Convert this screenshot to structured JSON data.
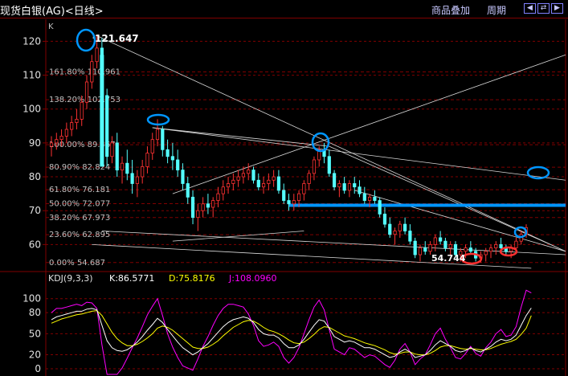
{
  "header": {
    "title": "现货白银(AG)<日线>",
    "menu_overlay": "商品叠加",
    "menu_period": "周期",
    "nav_icons": [
      "collapse-left-icon",
      "expand-icon",
      "collapse-right-icon"
    ]
  },
  "colors": {
    "bg": "#000000",
    "up": "#ff3232",
    "down": "#54ffff",
    "grid": "#800000",
    "k_line": "#ffffff",
    "d_line": "#ffff00",
    "j_line": "#ff00ff",
    "highlight": "#0096ff",
    "marker_red": "#ff3030"
  },
  "chart_data": [
    {
      "type": "candlestick",
      "panel_label": "K",
      "ylim": [
        52.5,
        126.5
      ],
      "y_ticks": [
        60,
        70,
        80,
        90,
        100,
        110,
        120
      ],
      "grid": true,
      "fib_levels": [
        {
          "label": "161.80% 110.961",
          "value": 110.961
        },
        {
          "label": "138.20% 102.753",
          "value": 102.753
        },
        {
          "label": "100.00% 89.467",
          "value": 89.467
        },
        {
          "label": "80.90% 82.824",
          "value": 82.824
        },
        {
          "label": "61.80% 76.181",
          "value": 76.181
        },
        {
          "label": "50.00% 72.077",
          "value": 72.077
        },
        {
          "label": "38.20% 67.973",
          "value": 67.973
        },
        {
          "label": "23.60% 62.895",
          "value": 62.895
        },
        {
          "label": "0.00% 54.687",
          "value": 54.687
        }
      ],
      "annotations": {
        "high_label": "121.647",
        "high_value": 121.647,
        "low_label": "54.744",
        "low_value": 54.744,
        "support_line": 71.6
      },
      "series": [
        {
          "name": "price",
          "values": [
            [
              89,
              92,
              86,
              90
            ],
            [
              90,
              93,
              88,
              91
            ],
            [
              91,
              94,
              89,
              92
            ],
            [
              92,
              96,
              90,
              94
            ],
            [
              94,
              98,
              92,
              96
            ],
            [
              96,
              100,
              94,
              97
            ],
            [
              97,
              104,
              95,
              102
            ],
            [
              102,
              110,
              100,
              108
            ],
            [
              108,
              116,
              106,
              114
            ],
            [
              114,
              121.6,
              112,
              118
            ],
            [
              118,
              121,
              100,
              104
            ],
            [
              104,
              106,
              83,
              86
            ],
            [
              86,
              92,
              84,
              90
            ],
            [
              90,
              93,
              80,
              82
            ],
            [
              82,
              86,
              78,
              84
            ],
            [
              84,
              88,
              79,
              81
            ],
            [
              81,
              85,
              75,
              78
            ],
            [
              78,
              82,
              74,
              80
            ],
            [
              80,
              85,
              78,
              83
            ],
            [
              83,
              89,
              81,
              87
            ],
            [
              87,
              93,
              85,
              91
            ],
            [
              91,
              97,
              89,
              94
            ],
            [
              94,
              95,
              86,
              88
            ],
            [
              88,
              91,
              84,
              86
            ],
            [
              86,
              90,
              82,
              85
            ],
            [
              85,
              88,
              80,
              82
            ],
            [
              82,
              84,
              76,
              78
            ],
            [
              78,
              80,
              72,
              74
            ],
            [
              74,
              76,
              66,
              68
            ],
            [
              68,
              72,
              64,
              70
            ],
            [
              70,
              74,
              68,
              72
            ],
            [
              72,
              75,
              69,
              71
            ],
            [
              71,
              74,
              68,
              73
            ],
            [
              73,
              77,
              71,
              75
            ],
            [
              75,
              79,
              73,
              77
            ],
            [
              77,
              80,
              75,
              78
            ],
            [
              78,
              81,
              76,
              79
            ],
            [
              79,
              82,
              77,
              80
            ],
            [
              80,
              83,
              78,
              81
            ],
            [
              81,
              84,
              79,
              82
            ],
            [
              82,
              83,
              78,
              79
            ],
            [
              79,
              81,
              76,
              77
            ],
            [
              77,
              80,
              75,
              78
            ],
            [
              78,
              81,
              76,
              79
            ],
            [
              79,
              82,
              77,
              80
            ],
            [
              80,
              82,
              75,
              76
            ],
            [
              76,
              78,
              72,
              73
            ],
            [
              73,
              75,
              70,
              72
            ],
            [
              72,
              75,
              70,
              73
            ],
            [
              73,
              76,
              71,
              75
            ],
            [
              75,
              79,
              73,
              78
            ],
            [
              78,
              82,
              76,
              81
            ],
            [
              81,
              86,
              79,
              85
            ],
            [
              85,
              89,
              83,
              88
            ],
            [
              88,
              90,
              84,
              86
            ],
            [
              86,
              88,
              80,
              81
            ],
            [
              81,
              82,
              76,
              77
            ],
            [
              77,
              79,
              74,
              78
            ],
            [
              78,
              80,
              75,
              76
            ],
            [
              76,
              79,
              74,
              78
            ],
            [
              78,
              80,
              75,
              77
            ],
            [
              77,
              79,
              74,
              75
            ],
            [
              75,
              77,
              72,
              73
            ],
            [
              73,
              75,
              71,
              74
            ],
            [
              74,
              76,
              72,
              73
            ],
            [
              73,
              74,
              68,
              69
            ],
            [
              69,
              71,
              65,
              66
            ],
            [
              66,
              68,
              62,
              63
            ],
            [
              63,
              65,
              60,
              64
            ],
            [
              64,
              67,
              62,
              66
            ],
            [
              66,
              68,
              63,
              64
            ],
            [
              64,
              66,
              60,
              61
            ],
            [
              61,
              62,
              56,
              57
            ],
            [
              57,
              60,
              55,
              59
            ],
            [
              59,
              61,
              57,
              58
            ],
            [
              58,
              61,
              57,
              60
            ],
            [
              60,
              63,
              58,
              62
            ],
            [
              62,
              64,
              60,
              61
            ],
            [
              61,
              62,
              58,
              59
            ],
            [
              59,
              61,
              57,
              60
            ],
            [
              60,
              61,
              56,
              57
            ],
            [
              57,
              59,
              55,
              58
            ],
            [
              58,
              60,
              56,
              59
            ],
            [
              59,
              61,
              57,
              58
            ],
            [
              58,
              59,
              55,
              56
            ],
            [
              56,
              58,
              54.7,
              57
            ],
            [
              57,
              59,
              55,
              58
            ],
            [
              58,
              60,
              56,
              59
            ],
            [
              59,
              61,
              57,
              60
            ],
            [
              60,
              62,
              58,
              59
            ],
            [
              59,
              60,
              57,
              58
            ],
            [
              58,
              60,
              56,
              59
            ],
            [
              59,
              62,
              58,
              61
            ],
            [
              61,
              64,
              60,
              63
            ],
            [
              63,
              66,
              62,
              65
            ]
          ]
        }
      ]
    },
    {
      "type": "line",
      "title": "KDJ(9,3,3)",
      "legend": [
        {
          "label": "K:86.5771",
          "series": "K"
        },
        {
          "label": "D:75.8176",
          "series": "D"
        },
        {
          "label": "J:108.0960",
          "series": "J"
        }
      ],
      "ylim": [
        -8,
        118
      ],
      "y_ticks": [
        0,
        20,
        50,
        80,
        100
      ],
      "series": [
        {
          "name": "K",
          "values": [
            70,
            74,
            76,
            78,
            80,
            82,
            82,
            85,
            86,
            84,
            62,
            40,
            30,
            26,
            25,
            27,
            32,
            38,
            46,
            55,
            63,
            72,
            66,
            56,
            47,
            38,
            30,
            25,
            20,
            24,
            30,
            36,
            44,
            52,
            60,
            66,
            70,
            72,
            74,
            72,
            66,
            56,
            50,
            48,
            48,
            44,
            36,
            30,
            30,
            34,
            42,
            52,
            62,
            70,
            68,
            58,
            46,
            42,
            38,
            40,
            38,
            34,
            30,
            30,
            28,
            24,
            20,
            16,
            18,
            24,
            28,
            24,
            16,
            18,
            20,
            26,
            34,
            40,
            36,
            32,
            26,
            24,
            26,
            30,
            26,
            24,
            28,
            32,
            38,
            42,
            40,
            42,
            48,
            62,
            76,
            86.6
          ]
        },
        {
          "name": "D",
          "values": [
            65,
            68,
            71,
            73,
            75,
            77,
            78,
            80,
            82,
            83,
            76,
            64,
            52,
            43,
            37,
            33,
            33,
            35,
            39,
            44,
            50,
            58,
            61,
            59,
            55,
            49,
            43,
            37,
            31,
            29,
            29,
            31,
            35,
            40,
            47,
            53,
            59,
            63,
            67,
            69,
            68,
            64,
            59,
            55,
            53,
            50,
            46,
            41,
            37,
            36,
            38,
            43,
            49,
            56,
            60,
            59,
            55,
            51,
            47,
            45,
            43,
            40,
            37,
            35,
            33,
            30,
            27,
            23,
            21,
            22,
            24,
            24,
            21,
            20,
            20,
            22,
            26,
            31,
            33,
            33,
            31,
            29,
            28,
            29,
            28,
            27,
            27,
            29,
            32,
            35,
            37,
            39,
            42,
            49,
            58,
            75.8
          ]
        },
        {
          "name": "J",
          "values": [
            80,
            86,
            86,
            88,
            90,
            92,
            90,
            95,
            94,
            86,
            34,
            -8,
            -8,
            -8,
            1,
            15,
            30,
            44,
            60,
            77,
            89,
            100,
            76,
            50,
            31,
            16,
            4,
            1,
            -2,
            14,
            32,
            46,
            62,
            76,
            86,
            92,
            92,
            90,
            88,
            78,
            62,
            40,
            32,
            34,
            38,
            32,
            16,
            8,
            16,
            30,
            50,
            70,
            88,
            98,
            84,
            56,
            28,
            24,
            20,
            30,
            28,
            22,
            16,
            20,
            18,
            12,
            6,
            2,
            12,
            28,
            36,
            24,
            6,
            14,
            20,
            34,
            50,
            58,
            42,
            30,
            16,
            14,
            22,
            32,
            22,
            18,
            30,
            38,
            50,
            56,
            46,
            48,
            60,
            88,
            112,
            108.1
          ]
        }
      ]
    }
  ]
}
